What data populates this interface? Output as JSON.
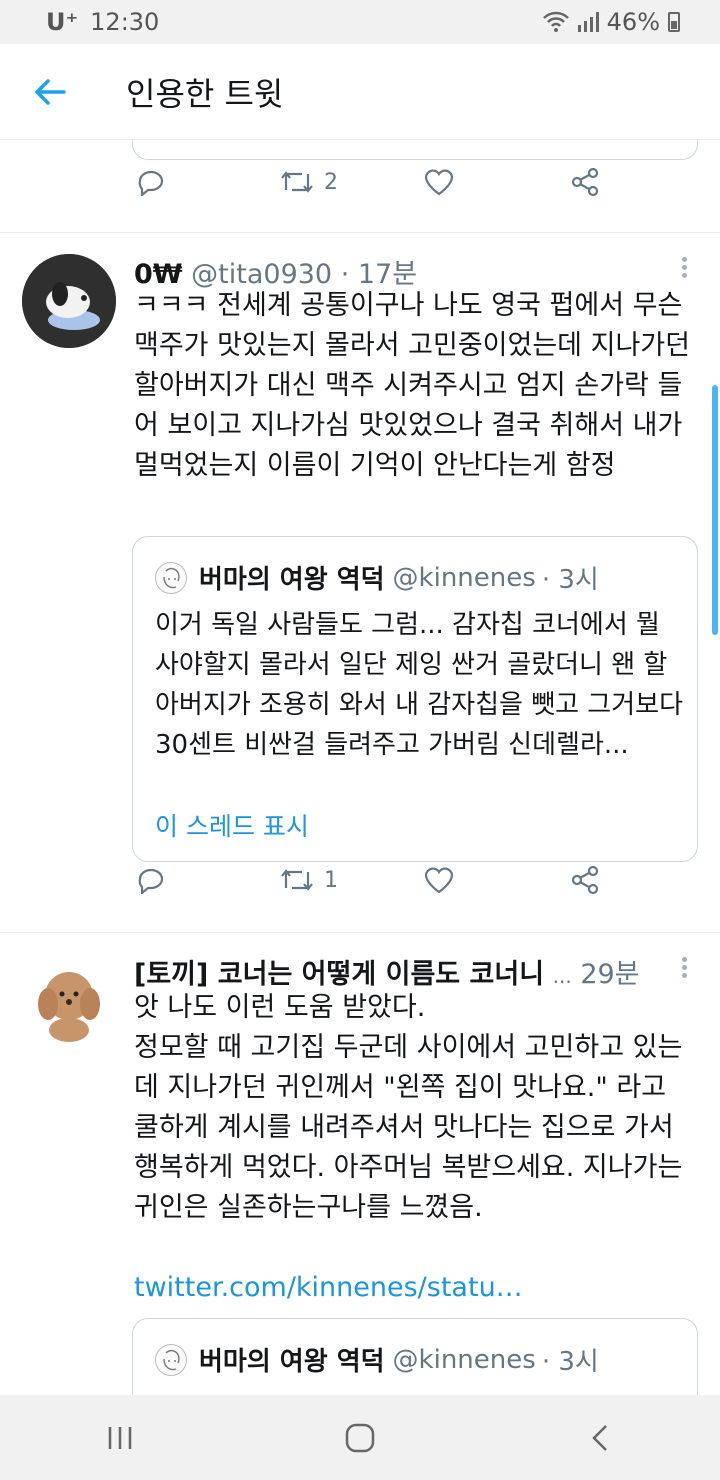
{
  "status_bar": {
    "carrier": "U⁺",
    "time": "12:30",
    "battery": "46%"
  },
  "app_bar": {
    "title": "인용한 트윗"
  },
  "tweets": [
    {
      "retweets": "2"
    },
    {
      "name": "0₩",
      "handle": "@tita0930",
      "time": "· 17분",
      "text": "ㅋㅋㅋ 전세계 공통이구나 나도 영국 펍에서 무슨 맥주가 맛있는지 몰라서 고민중이었는데 지나가던 할아버지가 대신 맥주 시켜주시고 엄지 손가락 들어 보이고 지나가심 맛있었으나 결국 취해서 내가 멀먹었는지 이름이 기억이 안난다는게 함정",
      "quote": {
        "name": "버마의 여왕 역덕",
        "handle": "@kinnenes",
        "time": "· 3시",
        "text": "이거 독일 사람들도 그럼... 감자칩 코너에서 뭘 사야할지 몰라서 일단 제잉 싼거 골랐더니 왠 할아버지가 조용히 와서 내 감자칩을 뺏고 그거보다 30센트 비싼걸 들려주고 가버림 신데렐라...",
        "thread_link": "이 스레드 표시"
      },
      "retweets": "1"
    },
    {
      "name": "[토끼] 코너는 어떻게 이름도 코너니",
      "ellipsis": "...",
      "time": "29분",
      "text": "앗 나도 이런 도움 받았다.\n정모할 때 고기집 두군데 사이에서 고민하고 있는데 지나가던 귀인께서 \"왼쪽 집이 맛나요.\" 라고 쿨하게 계시를 내려주셔서 맛나다는 집으로 가서 행복하게 먹었다. 아주머님 복받으세요. 지나가는 귀인은 실존하는구나를 느꼈음.",
      "link": "twitter.com/kinnenes/statu…",
      "quote": {
        "name": "버마의 여왕 역덕",
        "handle": "@kinnenes",
        "time": "· 3시"
      }
    }
  ]
}
